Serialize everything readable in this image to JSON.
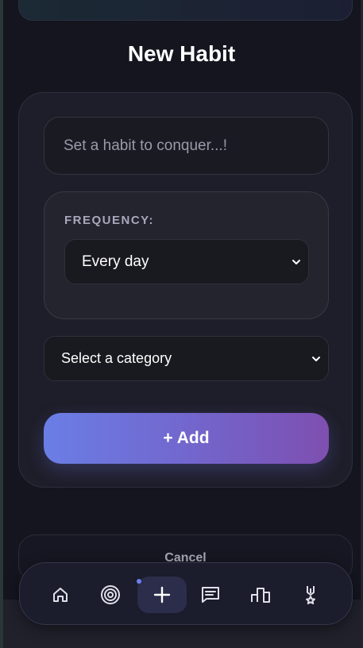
{
  "page": {
    "title": "New Habit"
  },
  "form": {
    "habit_input_placeholder": "Set a habit to conquer...!",
    "habit_input_value": "",
    "frequency": {
      "label": "FREQUENCY:",
      "selected": "Every day"
    },
    "category": {
      "selected": "Select a category"
    },
    "add_label": "+ Add"
  },
  "cancel_label": "Cancel",
  "bottom_nav": {
    "items": [
      {
        "icon": "home-icon"
      },
      {
        "icon": "target-icon"
      },
      {
        "icon": "plus-icon",
        "active": true,
        "badge_dot": true
      },
      {
        "icon": "chat-icon"
      },
      {
        "icon": "leaderboard-icon"
      },
      {
        "icon": "medal-icon"
      }
    ]
  },
  "colors": {
    "background": "#14151f",
    "card": "#1e1e2a",
    "accent_start": "#6a7ee6",
    "accent_end": "#7e4fb0",
    "nav_active": "#2b2d4a",
    "badge_dot": "#6d7ff0"
  }
}
